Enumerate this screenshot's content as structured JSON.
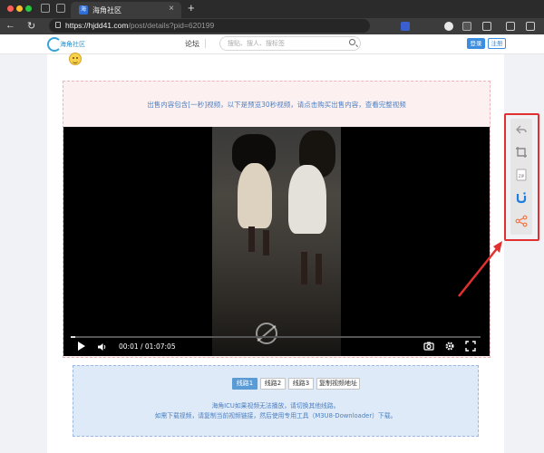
{
  "browser": {
    "tab_title": "海角社区",
    "tab_favicon_text": "海",
    "url_host": "https://hjdd41.com",
    "url_path": "/post/details?pid=620199"
  },
  "header": {
    "logo_text": "海角社区",
    "nav_forum": "论坛",
    "search_placeholder": "搜贴、搜人、搜标签",
    "login_label": "登录",
    "register_label": "注册"
  },
  "post": {
    "sale_notice": "出售内容包含[一秒]视频，以下是预览30秒视频，请点击购买出售内容，查看完整视频"
  },
  "video": {
    "time_display": "00:01 / 01:07:05",
    "progress": 0.01
  },
  "lines": {
    "buttons": [
      "线路1",
      "线路2",
      "线路3",
      "复制视频地址"
    ],
    "active_index": 0,
    "notice_1": "海角ICU如果视频无法播放，请切换其他线路。",
    "notice_2": "如需下载视频，请复制当前视频链接，然后使用专用工具（M3U8-Downloader）下载。"
  },
  "sidebar": {
    "icons": [
      "back-icon",
      "crop-icon",
      "zip-icon",
      "brand-logo-icon",
      "share-icon"
    ],
    "zip_label": "ZIP"
  },
  "colors": {
    "accent": "#3b8de0",
    "annotation_red": "#e03030"
  }
}
